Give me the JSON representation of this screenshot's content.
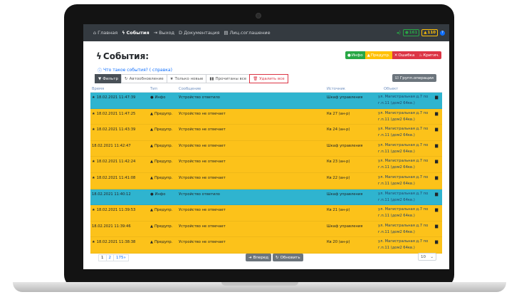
{
  "nav": {
    "items": [
      {
        "icon": "home-icon",
        "label": "Главная",
        "active": false
      },
      {
        "icon": "bolt-icon",
        "label": "События",
        "active": true
      },
      {
        "icon": "logout-icon",
        "label": "Выход",
        "active": false
      },
      {
        "icon": "doc-icon",
        "label": "Документация",
        "active": false
      },
      {
        "icon": "file-icon",
        "label": "Лиц.соглашение",
        "active": false
      }
    ],
    "counter_green": "161",
    "counter_yellow": "110"
  },
  "page": {
    "title": "События:",
    "help_link": "Что такое события? ( справка)"
  },
  "filters": {
    "info": "Инфо",
    "warn": "Предупр.",
    "error": "Ошибка",
    "crit": "Критич."
  },
  "toolbar": {
    "filter": "Фильтр",
    "auto": "Автообновление",
    "new_only": "Только новые",
    "read_all": "Прочитаны все",
    "delete_all": "Удалить все",
    "group_ops": "Групп.операции"
  },
  "table": {
    "headers": {
      "time": "Время",
      "type": "Тип",
      "message": "Сообщение",
      "source": "Источник",
      "object": "Объект"
    },
    "rows": [
      {
        "starred": true,
        "time": "18.02.2021 11:47:39",
        "type": "Инфо",
        "msg": "Устройство ответило",
        "source": "Шкаф управления",
        "object": "ул. Магистральная д.7 по г.п.11 (дом2 64кв.)",
        "level": "info"
      },
      {
        "starred": true,
        "time": "18.02.2021 11:47:25",
        "type": "Предупр.",
        "msg": "Устройство не отвечает",
        "source": "Кв 27 (ан-р)",
        "object": "ул. Магистральная д.7 по г.п.11 (дом2 64кв.)",
        "level": "warn"
      },
      {
        "starred": true,
        "time": "18.02.2021 11:43:39",
        "type": "Предупр.",
        "msg": "Устройство не отвечает",
        "source": "Кв 24 (ан-р)",
        "object": "ул. Магистральная д.7 по г.п.11 (дом2 64кв.)",
        "level": "warn"
      },
      {
        "starred": false,
        "time": "18.02.2021 11:42:47",
        "type": "Предупр.",
        "msg": "Устройство не отвечает",
        "source": "Шкаф управления",
        "object": "ул. Магистральная д.7 по г.п.11 (дом2 64кв.)",
        "level": "warn"
      },
      {
        "starred": true,
        "time": "18.02.2021 11:42:24",
        "type": "Предупр.",
        "msg": "Устройство не отвечает",
        "source": "Кв 23 (ан-р)",
        "object": "ул. Магистральная д.7 по г.п.11 (дом2 64кв.)",
        "level": "warn"
      },
      {
        "starred": true,
        "time": "18.02.2021 11:41:08",
        "type": "Предупр.",
        "msg": "Устройство не отвечает",
        "source": "Кв 22 (ан-р)",
        "object": "ул. Магистральная д.7 по г.п.11 (дом2 64кв.)",
        "level": "warn"
      },
      {
        "starred": false,
        "time": "18.02.2021 11:40:12",
        "type": "Инфо",
        "msg": "Устройство ответило",
        "source": "Шкаф управления",
        "object": "ул. Магистральная д.7 по г.п.11 (дом2 64кв.)",
        "level": "info"
      },
      {
        "starred": true,
        "time": "18.02.2021 11:39:53",
        "type": "Предупр.",
        "msg": "Устройство не отвечает",
        "source": "Кв 21 (ан-р)",
        "object": "ул. Магистральная д.7 по г.п.11 (дом2 64кв.)",
        "level": "warn"
      },
      {
        "starred": false,
        "time": "18.02.2021 11:39:46",
        "type": "Предупр.",
        "msg": "Устройство не отвечает",
        "source": "Шкаф управления",
        "object": "ул. Магистральная д.7 по г.п.11 (дом2 64кв.)",
        "level": "warn"
      },
      {
        "starred": true,
        "time": "18.02.2021 11:38:38",
        "type": "Предупр.",
        "msg": "Устройство не отвечает",
        "source": "Кв 20 (ан-р)",
        "object": "ул. Магистральная д.7 по г.п.11 (дом2 64кв.)",
        "level": "warn"
      }
    ]
  },
  "pagination": {
    "pages": [
      "1",
      "2",
      "175»"
    ]
  },
  "bottom": {
    "forward": "Вперед",
    "refresh": "Обновить",
    "per_page": "10"
  },
  "colors": {
    "info_row": "#2fb4cf",
    "warn_row": "#fcc21a",
    "navbar": "#343a40"
  }
}
